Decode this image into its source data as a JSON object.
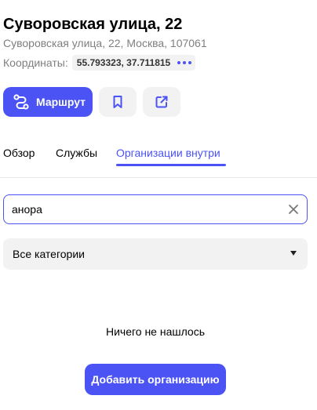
{
  "place": {
    "title": "Суворовская улица, 22",
    "address": "Суворовская улица, 22, Москва, 107061",
    "coordinates_label": "Координаты:",
    "coordinates_value": "55.793323, 37.711815"
  },
  "actions": {
    "route_label": "Маршрут"
  },
  "tabs": [
    {
      "label": "Обзор"
    },
    {
      "label": "Службы"
    },
    {
      "label": "Организации внутри",
      "active": true
    }
  ],
  "search": {
    "value": "анора"
  },
  "category_select": {
    "selected": "Все категории"
  },
  "empty_state": {
    "message": "Ничего не нашлось",
    "add_button_label": "Добавить организацию"
  },
  "colors": {
    "accent": "#4b53f5",
    "muted_text": "#7f7f7f",
    "chip_background": "#f2f2f2"
  },
  "icons": {
    "route": "route-icon",
    "bookmark": "bookmark-icon",
    "share": "share-icon",
    "more": "more-dots-icon",
    "clear": "clear-icon",
    "dropdown": "chevron-down-icon"
  }
}
